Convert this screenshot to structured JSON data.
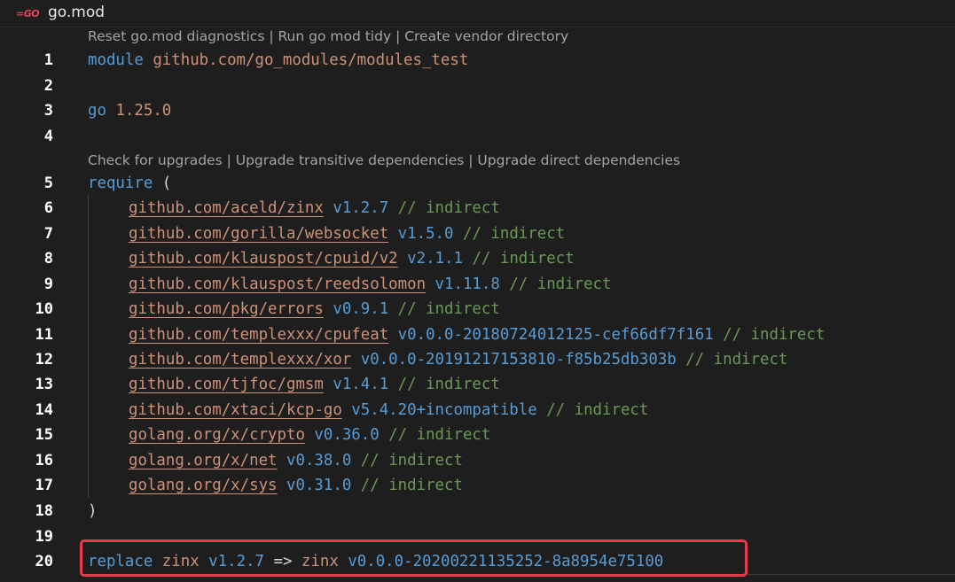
{
  "tab": {
    "icon": "go-icon",
    "icon_text": "=GO",
    "title": "go.mod"
  },
  "codelens": {
    "top": [
      "Reset go.mod diagnostics",
      "Run go mod tidy",
      "Create vendor directory"
    ],
    "require": [
      "Check for upgrades",
      "Upgrade transitive dependencies",
      "Upgrade direct dependencies"
    ]
  },
  "lines": {
    "l1": {
      "num": "1",
      "kw": "module",
      "path": "github.com/go_modules/modules_test"
    },
    "l2": {
      "num": "2"
    },
    "l3": {
      "num": "3",
      "kw": "go",
      "ver": "1.25.0"
    },
    "l4": {
      "num": "4"
    },
    "l5": {
      "num": "5",
      "kw": "require",
      "paren": "("
    },
    "deps": [
      {
        "num": "6",
        "mod": "github.com/aceld/zinx",
        "ver": "v1.2.7",
        "cmt": "// indirect"
      },
      {
        "num": "7",
        "mod": "github.com/gorilla/websocket",
        "ver": "v1.5.0",
        "cmt": "// indirect"
      },
      {
        "num": "8",
        "mod": "github.com/klauspost/cpuid/v2",
        "ver": "v2.1.1",
        "cmt": "// indirect"
      },
      {
        "num": "9",
        "mod": "github.com/klauspost/reedsolomon",
        "ver": "v1.11.8",
        "cmt": "// indirect"
      },
      {
        "num": "10",
        "mod": "github.com/pkg/errors",
        "ver": "v0.9.1",
        "cmt": "// indirect"
      },
      {
        "num": "11",
        "mod": "github.com/templexxx/cpufeat",
        "ver": "v0.0.0-20180724012125-cef66df7f161",
        "cmt": "// indirect"
      },
      {
        "num": "12",
        "mod": "github.com/templexxx/xor",
        "ver": "v0.0.0-20191217153810-f85b25db303b",
        "cmt": "// indirect"
      },
      {
        "num": "13",
        "mod": "github.com/tjfoc/gmsm",
        "ver": "v1.4.1",
        "cmt": "// indirect"
      },
      {
        "num": "14",
        "mod": "github.com/xtaci/kcp-go",
        "ver": "v5.4.20+incompatible",
        "cmt": "// indirect"
      },
      {
        "num": "15",
        "mod": "golang.org/x/crypto",
        "ver": "v0.36.0",
        "cmt": "// indirect"
      },
      {
        "num": "16",
        "mod": "golang.org/x/net",
        "ver": "v0.38.0",
        "cmt": "// indirect"
      },
      {
        "num": "17",
        "mod": "golang.org/x/sys",
        "ver": "v0.31.0",
        "cmt": "// indirect"
      }
    ],
    "l18": {
      "num": "18",
      "paren": ")"
    },
    "l19": {
      "num": "19"
    },
    "l20": {
      "num": "20",
      "kw": "replace",
      "old": "zinx",
      "old_ver": "v1.2.7",
      "arrow": "=>",
      "new": "zinx",
      "new_ver": "v0.0.0-20200221135252-8a8954e75100"
    }
  },
  "colors": {
    "keyword": "#569cd6",
    "string": "#ce9178",
    "comment": "#6a9955",
    "highlight": "#e83a4e"
  }
}
